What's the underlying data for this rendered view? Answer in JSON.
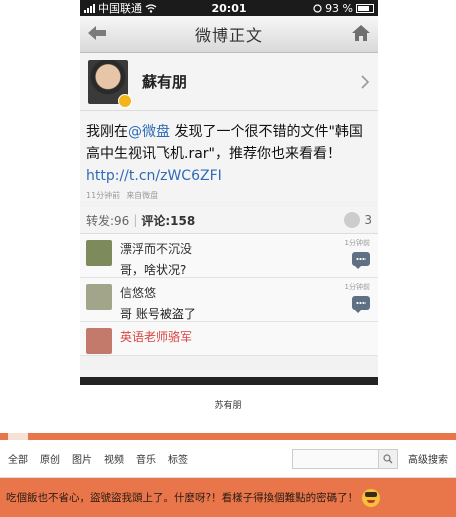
{
  "phone": {
    "status_bar": {
      "carrier": "中国联通",
      "time": "20:01",
      "battery": "93 %"
    },
    "nav": {
      "title": "微博正文"
    },
    "author": {
      "name": "蘇有朋"
    },
    "post": {
      "text_before_mention": "我刚在",
      "mention": "@微盘",
      "text_after_mention": " 发现了一个很不错的文件\"韩国高中生视讯飞机.rar\"，推荐你也来看看！ ",
      "link": "http://t.cn/zWC6ZFI",
      "time": "11分钟前",
      "source": "来自微盘"
    },
    "stats": {
      "repost": "转发:96",
      "comments": "评论:158",
      "likes": "3"
    },
    "comments": [
      {
        "name": "漂浮而不沉没",
        "text": "哥，啥状况?",
        "time": "1分钟前"
      },
      {
        "name": "信悠悠",
        "text": "哥 账号被盗了",
        "time": "1分钟前"
      },
      {
        "name": "英语老师骆军",
        "text": "",
        "time": ""
      }
    ]
  },
  "caption": "苏有朋",
  "search_bar": {
    "links": [
      "全部",
      "原创",
      "图片",
      "视频",
      "音乐",
      "标签"
    ],
    "advanced": "高级搜索"
  },
  "quote": {
    "text": "吃個飯也不省心，盜號盜我頭上了。什麼呀?！看樣子得換個難點的密碼了！"
  },
  "colors": {
    "orange": "#e9764a",
    "link_blue": "#2e6ab8"
  }
}
